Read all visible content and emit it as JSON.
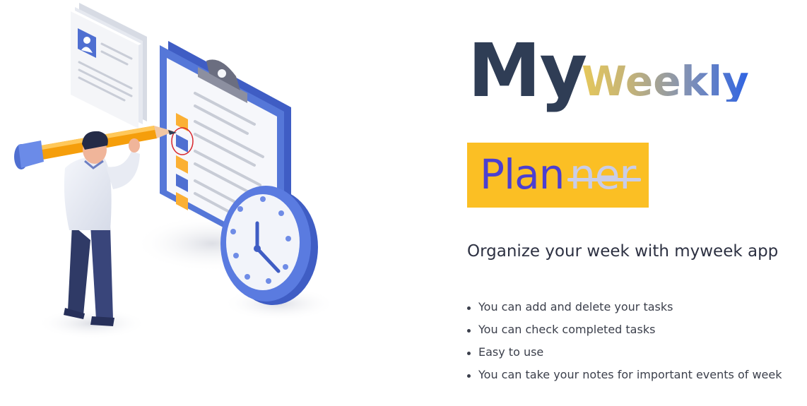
{
  "hero": {
    "title_my": "My",
    "title_weekly": "Weekly",
    "planner_plan": "Plan",
    "planner_ner": "ner",
    "subtitle": "Organize your week with myweek app",
    "features": [
      "You can add and delete your tasks",
      "You can check completed tasks",
      "Easy to use",
      "You can take your notes for important events of week"
    ]
  },
  "colors": {
    "title_dark": "#2f3d55",
    "weekly_gradient": [
      "#e6c85a",
      "#2e63e3"
    ],
    "planner_bg": "#fbbf24",
    "planner_text": "#4c3fd0",
    "struck_text": "#c9cde8",
    "illustration_blue": "#4f6fd1",
    "illustration_orange": "#f59e0b"
  },
  "illustration": {
    "icons": [
      "profile-document-icon",
      "clipboard-checklist-icon",
      "wall-clock-icon",
      "pencil-icon",
      "person-figure"
    ]
  }
}
